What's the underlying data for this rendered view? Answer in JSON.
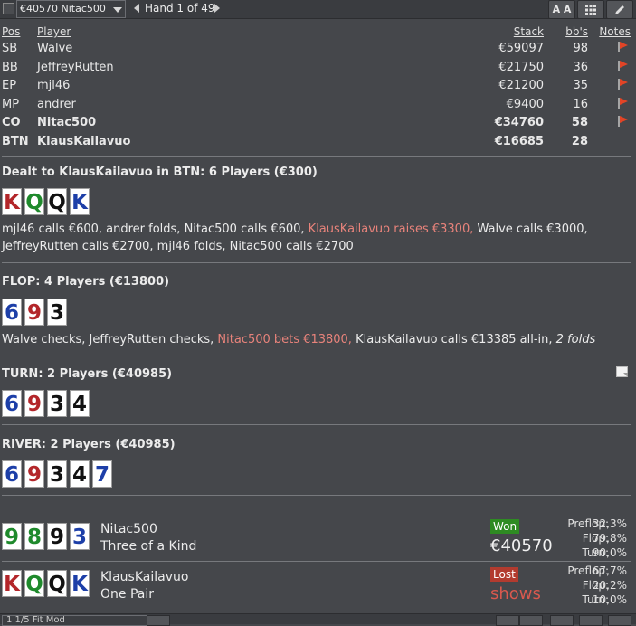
{
  "toolbar": {
    "selected_table": "€40570 Nitac500",
    "hand_label": "Hand 1 of 49",
    "font_button": "A A",
    "grid_icon": "grid-icon",
    "edit_icon": "pencil-icon"
  },
  "players": {
    "headers": {
      "pos": "Pos",
      "player": "Player",
      "stack": "Stack",
      "bbs": "bb's",
      "notes": "Notes"
    },
    "rows": [
      {
        "pos": "SB",
        "name": "Walve",
        "stack": "€59097",
        "bbs": "98",
        "flag": true,
        "bold": false
      },
      {
        "pos": "BB",
        "name": "JeffreyRutten",
        "stack": "€21750",
        "bbs": "36",
        "flag": true,
        "bold": false
      },
      {
        "pos": "EP",
        "name": "mjl46",
        "stack": "€21200",
        "bbs": "35",
        "flag": true,
        "bold": false
      },
      {
        "pos": "MP",
        "name": "andrer",
        "stack": "€9400",
        "bbs": "16",
        "flag": true,
        "bold": false
      },
      {
        "pos": "CO",
        "name": "Nitac500",
        "stack": "€34760",
        "bbs": "58",
        "flag": true,
        "bold": true
      },
      {
        "pos": "BTN",
        "name": "KlausKailavuo",
        "stack": "€16685",
        "bbs": "28",
        "flag": false,
        "bold": true
      }
    ]
  },
  "preflop": {
    "title": "Dealt to KlausKailavuo in BTN: 6 Players (€300)",
    "cards": [
      {
        "rank": "K",
        "color": "#b3262a"
      },
      {
        "rank": "Q",
        "color": "#1f8a2c"
      },
      {
        "rank": "Q",
        "color": "#111111"
      },
      {
        "rank": "K",
        "color": "#1d3fa8"
      }
    ],
    "action_1": "mjl46 calls €600, andrer folds, Nitac500 calls €600, ",
    "action_red": "KlausKailavuo raises €3300,",
    "action_2": " Walve calls €3000, JeffreyRutten calls €2700, mjl46 folds, Nitac500 calls €2700"
  },
  "flop": {
    "title": "FLOP: 4 Players (€13800)",
    "cards": [
      {
        "rank": "6",
        "color": "#1d3fa8"
      },
      {
        "rank": "9",
        "color": "#b3262a"
      },
      {
        "rank": "3",
        "color": "#111111"
      }
    ],
    "action_1": "Walve checks, JeffreyRutten checks, ",
    "action_red": "Nitac500 bets €13800,",
    "action_2": " KlausKailavuo calls €13385 all-in, ",
    "action_it": "2 folds"
  },
  "turn": {
    "title": "TURN: 2 Players (€40985)",
    "cards": [
      {
        "rank": "6",
        "color": "#1d3fa8"
      },
      {
        "rank": "9",
        "color": "#b3262a"
      },
      {
        "rank": "3",
        "color": "#111111"
      },
      {
        "rank": "4",
        "color": "#111111"
      }
    ]
  },
  "river": {
    "title": "RIVER: 2 Players (€40985)",
    "cards": [
      {
        "rank": "6",
        "color": "#1d3fa8"
      },
      {
        "rank": "9",
        "color": "#b3262a"
      },
      {
        "rank": "3",
        "color": "#111111"
      },
      {
        "rank": "4",
        "color": "#111111"
      },
      {
        "rank": "7",
        "color": "#1d3fa8"
      }
    ]
  },
  "showdown": [
    {
      "name": "Nitac500",
      "hand": "Three of a Kind",
      "result": "Won",
      "amount": "€40570",
      "cards": [
        {
          "rank": "9",
          "color": "#1f8a2c"
        },
        {
          "rank": "8",
          "color": "#1f8a2c"
        },
        {
          "rank": "9",
          "color": "#111111"
        },
        {
          "rank": "3",
          "color": "#1d3fa8"
        }
      ],
      "equity": [
        {
          "label": "Preflop:",
          "value": "32,3%"
        },
        {
          "label": "Flop:",
          "value": "79,8%"
        },
        {
          "label": "Turn:",
          "value": "90,0%"
        }
      ]
    },
    {
      "name": "KlausKailavuo",
      "hand": "One Pair",
      "result": "Lost",
      "amount": "shows",
      "cards": [
        {
          "rank": "K",
          "color": "#b3262a"
        },
        {
          "rank": "Q",
          "color": "#1f8a2c"
        },
        {
          "rank": "Q",
          "color": "#111111"
        },
        {
          "rank": "K",
          "color": "#1d3fa8"
        }
      ],
      "equity": [
        {
          "label": "Preflop:",
          "value": "67,7%"
        },
        {
          "label": "Flop:",
          "value": "20,2%"
        },
        {
          "label": "Turn:",
          "value": "10,0%"
        }
      ]
    }
  ],
  "bottombar": {
    "select_value": "1 1/5 Fit Mod"
  }
}
